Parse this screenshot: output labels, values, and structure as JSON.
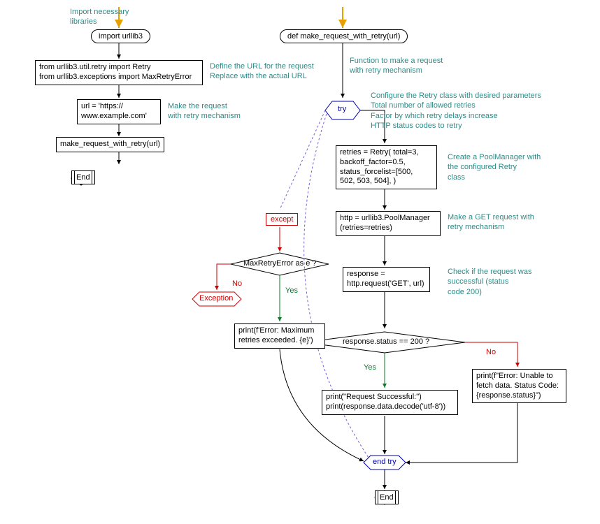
{
  "left": {
    "comment_import": "Import necessary\nlibraries",
    "import_stmt": "import urllib3",
    "from_stmts": "from urllib3.util.retry import Retry\nfrom urllib3.exceptions import MaxRetryError",
    "comment_url": "Define the URL for the request\nReplace with the actual URL",
    "url_assign": "url = 'https://\nwww.example.com'",
    "comment_make": "Make the request\nwith retry mechanism",
    "call": "make_request_with_retry(url)",
    "end": "End"
  },
  "right": {
    "fn_def": "def make_request_with_retry(url)",
    "comment_fn": "Function to make a request\nwith retry mechanism",
    "try_kw": "try",
    "comment_retry": "Configure the Retry class with desired parameters\nTotal number of allowed retries\nFactor by which retry delays increase\nHTTP status codes to retry",
    "retries_assign": "retries = Retry( total=3,\nbackoff_factor=0.5,\nstatus_forcelist=[500,\n502, 503, 504], )",
    "comment_pool": "Create a PoolManager with\nthe configured Retry\nclass",
    "http_assign": "http = urllib3.PoolManager\n(retries=retries)",
    "comment_get": "Make a GET request with\nretry mechanism",
    "response_assign": "response =\nhttp.request('GET', url)",
    "comment_check": "Check if the request was\nsuccessful (status\ncode 200)",
    "cond": "response.status == 200 ?",
    "yes": "Yes",
    "no": "No",
    "print_success": "print(\"Request Successful:\")\nprint(response.data.decode('utf-8'))",
    "print_error": "print(f\"Error: Unable to\nfetch data. Status Code:\n{response.status}\")",
    "except_kw": "except",
    "except_cond": "MaxRetryError as e ?",
    "exception_label": "Exception",
    "print_except": "print(f'Error: Maximum\nretries exceeded. {e}')",
    "end_try": "end try",
    "end": "End"
  }
}
